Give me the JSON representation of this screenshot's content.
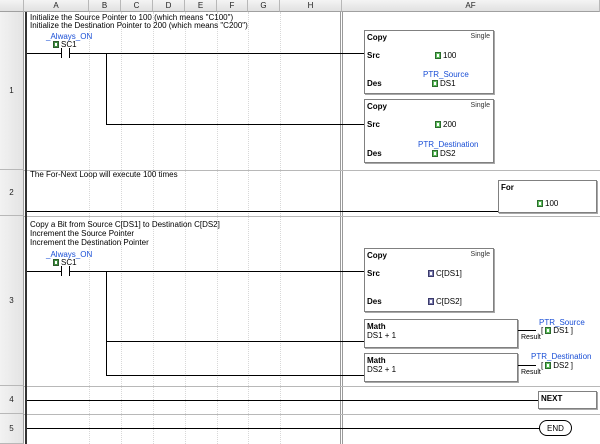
{
  "columns": [
    "A",
    "B",
    "C",
    "D",
    "E",
    "F",
    "G",
    "H",
    "AF"
  ],
  "rows": [
    "1",
    "2",
    "3",
    "4",
    "5"
  ],
  "rung1": {
    "comment_line1": "Initialize the Source Pointer to 100 (which means \"C100\")",
    "comment_line2": "Initialize the Destination Pointer to 200 (which means \"C200\")",
    "contact_nickname": "_Always_ON",
    "contact_address": "SC1",
    "copy1": {
      "title": "Copy",
      "mode": "Single",
      "src_label": "Src",
      "src_value": "100",
      "des_label": "Des",
      "des_nickname": "PTR_Source",
      "des_value": "DS1"
    },
    "copy2": {
      "title": "Copy",
      "mode": "Single",
      "src_label": "Src",
      "src_value": "200",
      "des_label": "Des",
      "des_nickname": "PTR_Destination",
      "des_value": "DS2"
    }
  },
  "rung2": {
    "comment": "The For-Next Loop will execute 100 times",
    "for_title": "For",
    "for_value": "100"
  },
  "rung3": {
    "comment_line1": "Copy a Bit from Source C[DS1] to Destination C[DS2]",
    "comment_line2": "Increment the Source Pointer",
    "comment_line3": "Increment the Destination Pointer",
    "contact_nickname": "_Always_ON",
    "contact_address": "SC1",
    "copy": {
      "title": "Copy",
      "mode": "Single",
      "src_label": "Src",
      "src_value": "C[DS1]",
      "des_label": "Des",
      "des_value": "C[DS2]"
    },
    "math1": {
      "title": "Math",
      "expression": "DS1 + 1",
      "result_label": "Result",
      "result_nickname": "PTR_Source",
      "result_value": "DS1"
    },
    "math2": {
      "title": "Math",
      "expression": "DS2 + 1",
      "result_label": "Result",
      "result_nickname": "PTR_Destination",
      "result_value": "DS2"
    }
  },
  "rung4": {
    "next_label": "NEXT"
  },
  "rung5": {
    "end_label": "END"
  }
}
